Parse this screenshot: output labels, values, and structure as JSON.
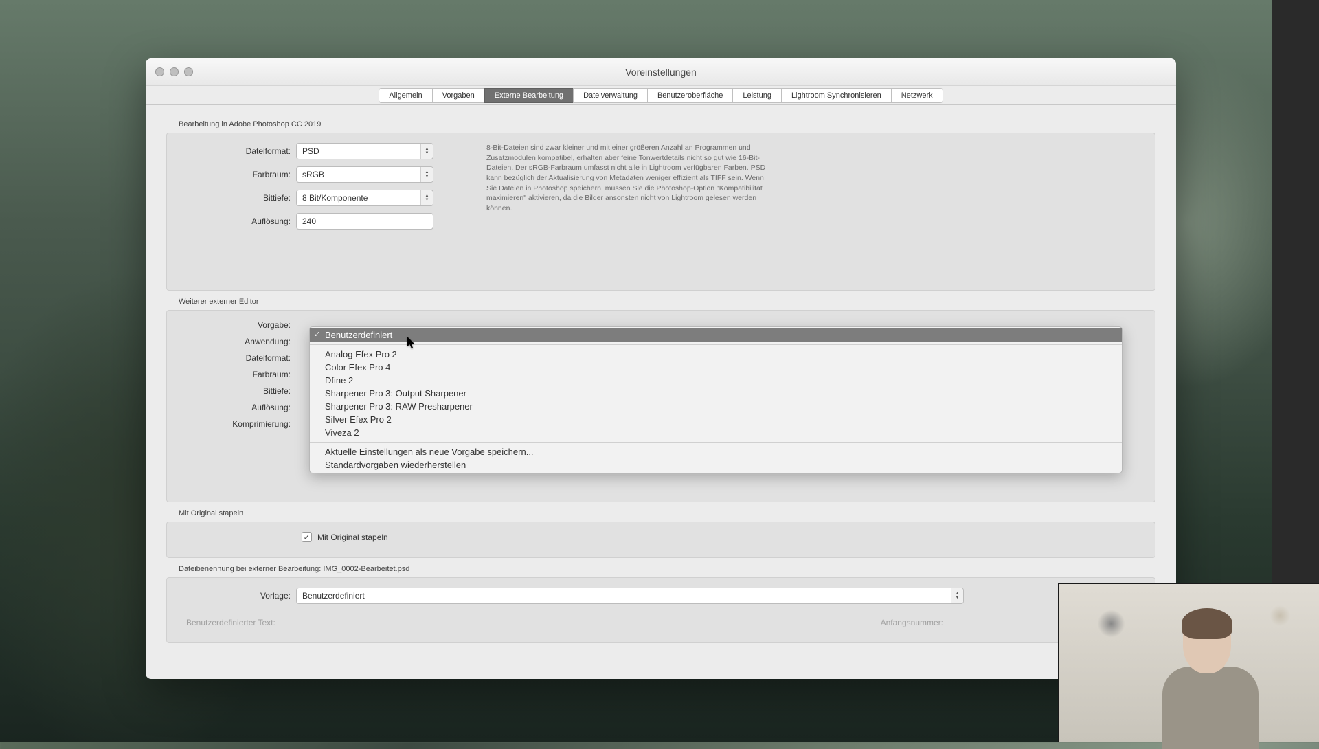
{
  "window": {
    "title": "Voreinstellungen"
  },
  "tabs": [
    "Allgemein",
    "Vorgaben",
    "Externe Bearbeitung",
    "Dateiverwaltung",
    "Benutzeroberfläche",
    "Leistung",
    "Lightroom Synchronisieren",
    "Netzwerk"
  ],
  "active_tab_index": 2,
  "section1": {
    "title": "Bearbeitung in Adobe Photoshop CC 2019",
    "rows": {
      "format_label": "Dateiformat:",
      "format_value": "PSD",
      "space_label": "Farbraum:",
      "space_value": "sRGB",
      "depth_label": "Bittiefe:",
      "depth_value": "8 Bit/Komponente",
      "res_label": "Auflösung:",
      "res_value": "240"
    },
    "info": "8-Bit-Dateien sind zwar kleiner und mit einer größeren Anzahl an Programmen und Zusatzmodulen kompatibel, erhalten aber feine Tonwertdetails nicht so gut wie 16-Bit-Dateien. Der sRGB-Farbraum umfasst nicht alle in Lightroom verfügbaren Farben. PSD kann bezüglich der Aktualisierung von Metadaten weniger effizient als TIFF sein. Wenn Sie Dateien in Photoshop speichern, müssen Sie die Photoshop-Option \"Kompatibilität maximieren\" aktivieren, da die Bilder ansonsten nicht von Lightroom gelesen werden können."
  },
  "section2": {
    "title": "Weiterer externer Editor",
    "labels": {
      "preset": "Vorgabe:",
      "app": "Anwendung:",
      "format": "Dateiformat:",
      "space": "Farbraum:",
      "depth": "Bittiefe:",
      "res": "Auflösung:",
      "comp": "Komprimierung:"
    }
  },
  "dropdown": {
    "selected": "Benutzerdefiniert",
    "items": [
      "Analog Efex Pro 2",
      "Color Efex Pro 4",
      "Dfine 2",
      "Sharpener Pro 3: Output Sharpener",
      "Sharpener Pro 3: RAW Presharpener",
      "Silver Efex Pro 2",
      "Viveza 2"
    ],
    "footer": [
      "Aktuelle Einstellungen als neue Vorgabe speichern...",
      "Standardvorgaben wiederherstellen"
    ]
  },
  "stack": {
    "title": "Mit Original stapeln",
    "checkbox_label": "Mit Original stapeln",
    "checked": true
  },
  "naming": {
    "title": "Dateibenennung bei externer Bearbeitung: IMG_0002-Bearbeitet.psd",
    "template_label": "Vorlage:",
    "template_value": "Benutzerdefiniert",
    "custom_text_label": "Benutzerdefinierter Text:",
    "start_label": "Anfangsnummer:"
  }
}
